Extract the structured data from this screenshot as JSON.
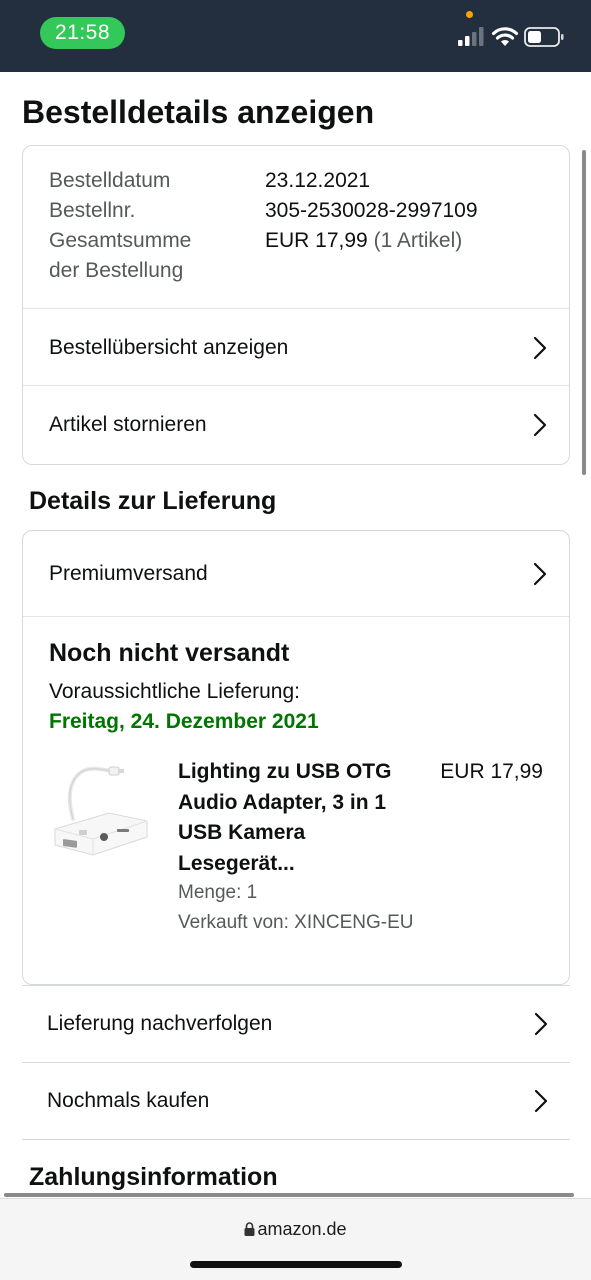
{
  "status_bar": {
    "time": "21:58"
  },
  "page": {
    "title": "Bestelldetails anzeigen"
  },
  "order": {
    "date_label": "Bestelldatum",
    "date_value": "23.12.2021",
    "number_label": "Bestellnr.",
    "number_value": "305-2530028-2997109",
    "total_label_1": "Gesamtsumme",
    "total_label_2": "der Bestellung",
    "total_value": "EUR 17,99",
    "total_count": "(1 Artikel)",
    "links": [
      "Bestellübersicht anzeigen",
      "Artikel stornieren"
    ]
  },
  "delivery": {
    "section_title": "Details zur Lieferung",
    "shipping_method": "Premiumversand",
    "status": "Noch nicht versandt",
    "expected_label": "Voraussichtliche Lieferung:",
    "expected_date": "Freitag, 24. Dezember 2021",
    "product": {
      "title": "Lighting zu USB OTG Audio Adapter, 3 in 1 USB Kamera Lesegerät...",
      "price": "EUR 17,99",
      "quantity": "Menge: 1",
      "seller": "Verkauft von: XINCENG-EU"
    },
    "actions": [
      "Lieferung nachverfolgen",
      "Nochmals kaufen"
    ]
  },
  "payment": {
    "section_title": "Zahlungsinformation"
  },
  "browser": {
    "url": "amazon.de"
  },
  "colors": {
    "header": "#232f3e",
    "time_pill": "#34c759",
    "delivery_date": "#007600",
    "border": "#d5d9d9"
  },
  "icons": [
    "signal-icon",
    "wifi-icon",
    "battery-icon",
    "chevron-right-icon",
    "lock-icon"
  ]
}
